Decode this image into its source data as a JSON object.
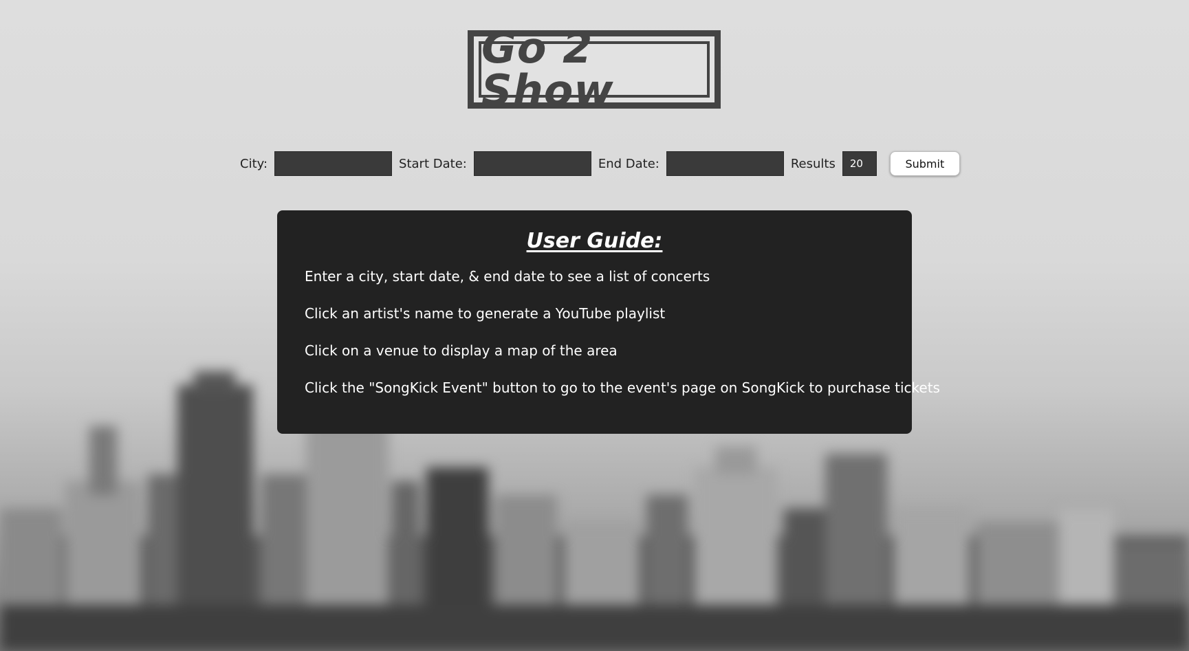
{
  "logo": {
    "text": "Go 2 Show"
  },
  "search": {
    "city_label": "City:",
    "city_value": "",
    "start_label": "Start Date:",
    "start_value": "",
    "end_label": "End Date:",
    "end_value": "",
    "results_label": "Results",
    "results_value": "20",
    "submit_label": "Submit"
  },
  "guide": {
    "title": "User Guide:",
    "items": [
      "Enter a city, start date, & end date to see a list of concerts",
      "Click an artist's name to generate a YouTube playlist",
      "Click on a venue to display a map of the area",
      "Click the \"SongKick Event\" button to go to the event's page on SongKick to purchase tickets"
    ]
  },
  "colors": {
    "input_bg": "#3a3a3a",
    "guide_bg": "#222222",
    "logo": "#444444"
  }
}
